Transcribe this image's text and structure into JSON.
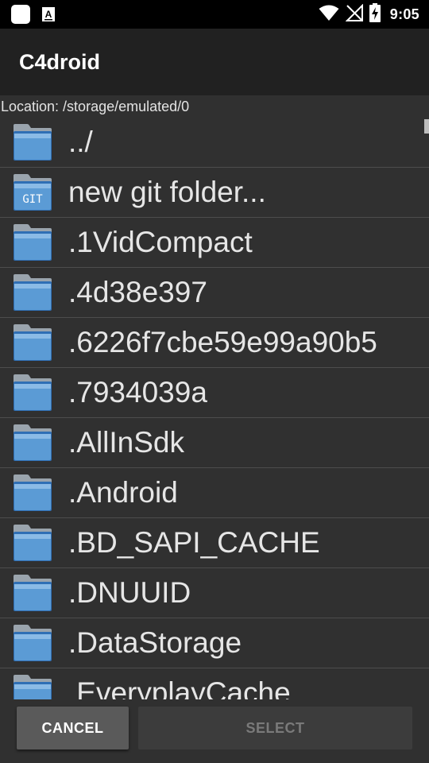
{
  "status_bar": {
    "time": "9:05",
    "icons": [
      "app-notification-icon",
      "a-notification-icon",
      "wifi-icon",
      "no-signal-icon",
      "battery-charging-icon"
    ]
  },
  "app_bar": {
    "title": "C4droid"
  },
  "location": {
    "text": "Location: /storage/emulated/0"
  },
  "files": [
    {
      "name": "../",
      "icon": "folder-icon"
    },
    {
      "name": "new git folder...",
      "icon": "git-folder-icon"
    },
    {
      "name": ".1VidCompact",
      "icon": "folder-icon"
    },
    {
      "name": ".4d38e397",
      "icon": "folder-icon"
    },
    {
      "name": ".6226f7cbe59e99a90b5",
      "icon": "folder-icon"
    },
    {
      "name": ".7934039a",
      "icon": "folder-icon"
    },
    {
      "name": ".AllInSdk",
      "icon": "folder-icon"
    },
    {
      "name": ".Android",
      "icon": "folder-icon"
    },
    {
      "name": ".BD_SAPI_CACHE",
      "icon": "folder-icon"
    },
    {
      "name": ".DNUUID",
      "icon": "folder-icon"
    },
    {
      "name": ".DataStorage",
      "icon": "folder-icon"
    },
    {
      "name": ".EveryplayCache",
      "icon": "folder-icon"
    }
  ],
  "buttons": {
    "cancel_label": "CANCEL",
    "select_label": "SELECT"
  },
  "git_icon_label": "GIT",
  "colors": {
    "status_bar_bg": "#000000",
    "app_bar_bg": "#212121",
    "content_bg": "#303030",
    "folder_blue": "#5b9bd5",
    "folder_tab": "#9aa4ad"
  }
}
